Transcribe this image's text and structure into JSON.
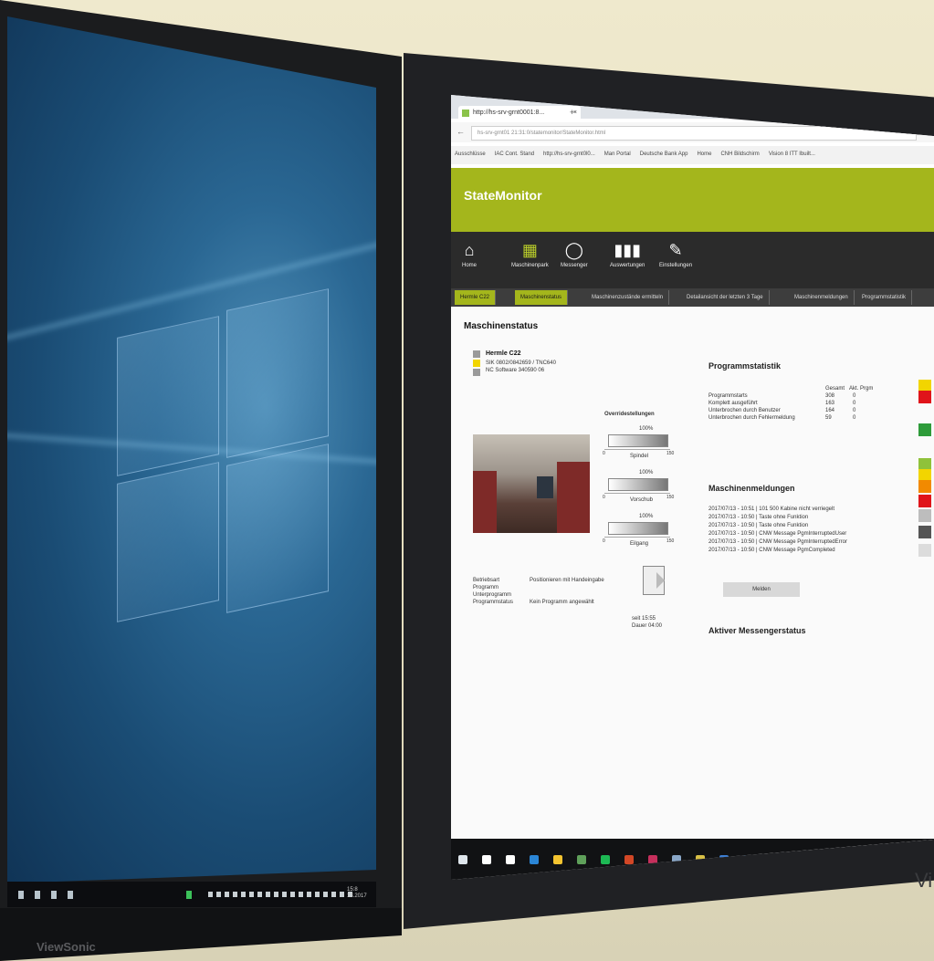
{
  "left_monitor": {
    "os": "Windows 10 desktop",
    "taskbar_clock": "15:8\n13.2017",
    "brand": "ViewSonic"
  },
  "right_monitor": {
    "brand": "Vi",
    "browser": {
      "tab_title": "http://hs-srv-grnt0001:8...",
      "tab_close": "×",
      "new_tab": "+",
      "url": "hs-srv-grnt01 21:31:0/statemonitor/StateMonitor.html",
      "bookmarks": [
        "Ausschlüsse",
        "IAC Cont. Stand",
        "http://hs-srv-grnt0l0...",
        "Man Portal",
        "Deutsche Bank App",
        "Home",
        "CNH Bildschirm",
        "Vision 8 ITT Ibuilt..."
      ]
    },
    "app": {
      "title": "StateMonitor",
      "nav": [
        {
          "label": "Home",
          "icon": "home-icon",
          "glyph": "⌂"
        },
        {
          "label": "Maschinenpark",
          "icon": "grid-icon",
          "glyph": "▦"
        },
        {
          "label": "Messenger",
          "icon": "chat-icon",
          "glyph": "◯"
        },
        {
          "label": "Auswertungen",
          "icon": "bar-chart-icon",
          "glyph": "▮▮▮"
        },
        {
          "label": "Einstellungen",
          "icon": "wrench-icon",
          "glyph": "✎"
        }
      ],
      "subtabs": [
        "Hermle C22",
        "Maschinenstatus",
        "Maschinenzustände ermitteln",
        "Detailansicht der letzten 3 Tage",
        "Maschinenmeldungen",
        "Programmstatistik"
      ],
      "page_title": "Maschinenstatus",
      "machine": {
        "name": "Hermle C22",
        "line1": "SIK 0802/0842659 / TNC640",
        "line2": "NC Software 340590 06",
        "legend_colors": [
          "#9a9a9a",
          "#f2d500",
          "#9a9a9a"
        ]
      },
      "overrides": {
        "title": "Overridestellungen",
        "items": [
          {
            "label": "Spindel",
            "pct": "100%",
            "value": 1.0
          },
          {
            "label": "Vorschub",
            "pct": "100%",
            "value": 1.0
          },
          {
            "label": "Eilgang",
            "pct": "100%",
            "value": 1.0
          }
        ],
        "axis_min": "0",
        "axis_max": "150"
      },
      "status_fields": [
        {
          "k": "Betriebsart",
          "v": "Positionieren mit Handeingabe"
        },
        {
          "k": "Programm",
          "v": ""
        },
        {
          "k": "Unterprogramm",
          "v": ""
        },
        {
          "k": "Programmstatus",
          "v": "Kein Programm angewählt"
        }
      ],
      "timing": {
        "seit": "seit  15:55",
        "dauer": "Dauer  04:00"
      },
      "program_stats": {
        "title": "Programmstatistik",
        "headers": [
          "Gesamt",
          "Akt. Prgm"
        ],
        "rows": [
          {
            "k": "Programmstarts",
            "a": "308",
            "b": "0"
          },
          {
            "k": "Komplett ausgeführt",
            "a": "163",
            "b": "0"
          },
          {
            "k": "Unterbrochen durch Benutzer",
            "a": "164",
            "b": "0"
          },
          {
            "k": "Unterbrochen durch Fehlermeldung",
            "a": "59",
            "b": "0"
          }
        ]
      },
      "messages": {
        "title": "Maschinenmeldungen",
        "items": [
          "2017/07/13 - 10:51 | 101 500 Kabine nicht verriegelt",
          "2017/07/13 - 10:50 | Taste ohne Funktion",
          "2017/07/13 - 10:50 | Taste ohne Funktion",
          "2017/07/13 - 10:50 | CNW Message PgmInterruptedUser",
          "2017/07/13 - 10:50 | CNW Message PgmInterruptedError",
          "2017/07/13 - 10:50 | CNW Message PgmCompleted"
        ],
        "button": "Melden"
      },
      "messenger_status": "Aktiver Messengerstatus",
      "side_colors": [
        "#f2d500",
        "#e0141a",
        "#2e9b3a",
        "#8fc23a",
        "#f2d500",
        "#f28a00",
        "#e0141a",
        "#bdbdbd",
        "#555555",
        "#dcdcdc"
      ]
    },
    "taskbar_icons": [
      {
        "name": "start-icon",
        "color": "#dfe6ec"
      },
      {
        "name": "cortana-icon",
        "color": "#ffffff"
      },
      {
        "name": "taskview-icon",
        "color": "#ffffff"
      },
      {
        "name": "edge-icon",
        "color": "#2b86d6"
      },
      {
        "name": "explorer-icon",
        "color": "#f4c430"
      },
      {
        "name": "chrome-icon",
        "color": "#5fa05a"
      },
      {
        "name": "spotify-icon",
        "color": "#1db954"
      },
      {
        "name": "office-icon",
        "color": "#d24726"
      },
      {
        "name": "app-icon",
        "color": "#c62f5c"
      },
      {
        "name": "tool-icon",
        "color": "#8aa7c8"
      },
      {
        "name": "paint-icon",
        "color": "#d8c046"
      },
      {
        "name": "pin-icon",
        "color": "#3d7ed3"
      },
      {
        "name": "network-icon",
        "color": "#5aa0e0"
      },
      {
        "name": "word-icon",
        "color": "#4f7bd0"
      },
      {
        "name": "excel-icon",
        "color": "#3e9a57"
      },
      {
        "name": "chart-icon",
        "color": "#5b8fd6"
      },
      {
        "name": "calc-icon",
        "color": "#c0c7d0"
      }
    ]
  }
}
